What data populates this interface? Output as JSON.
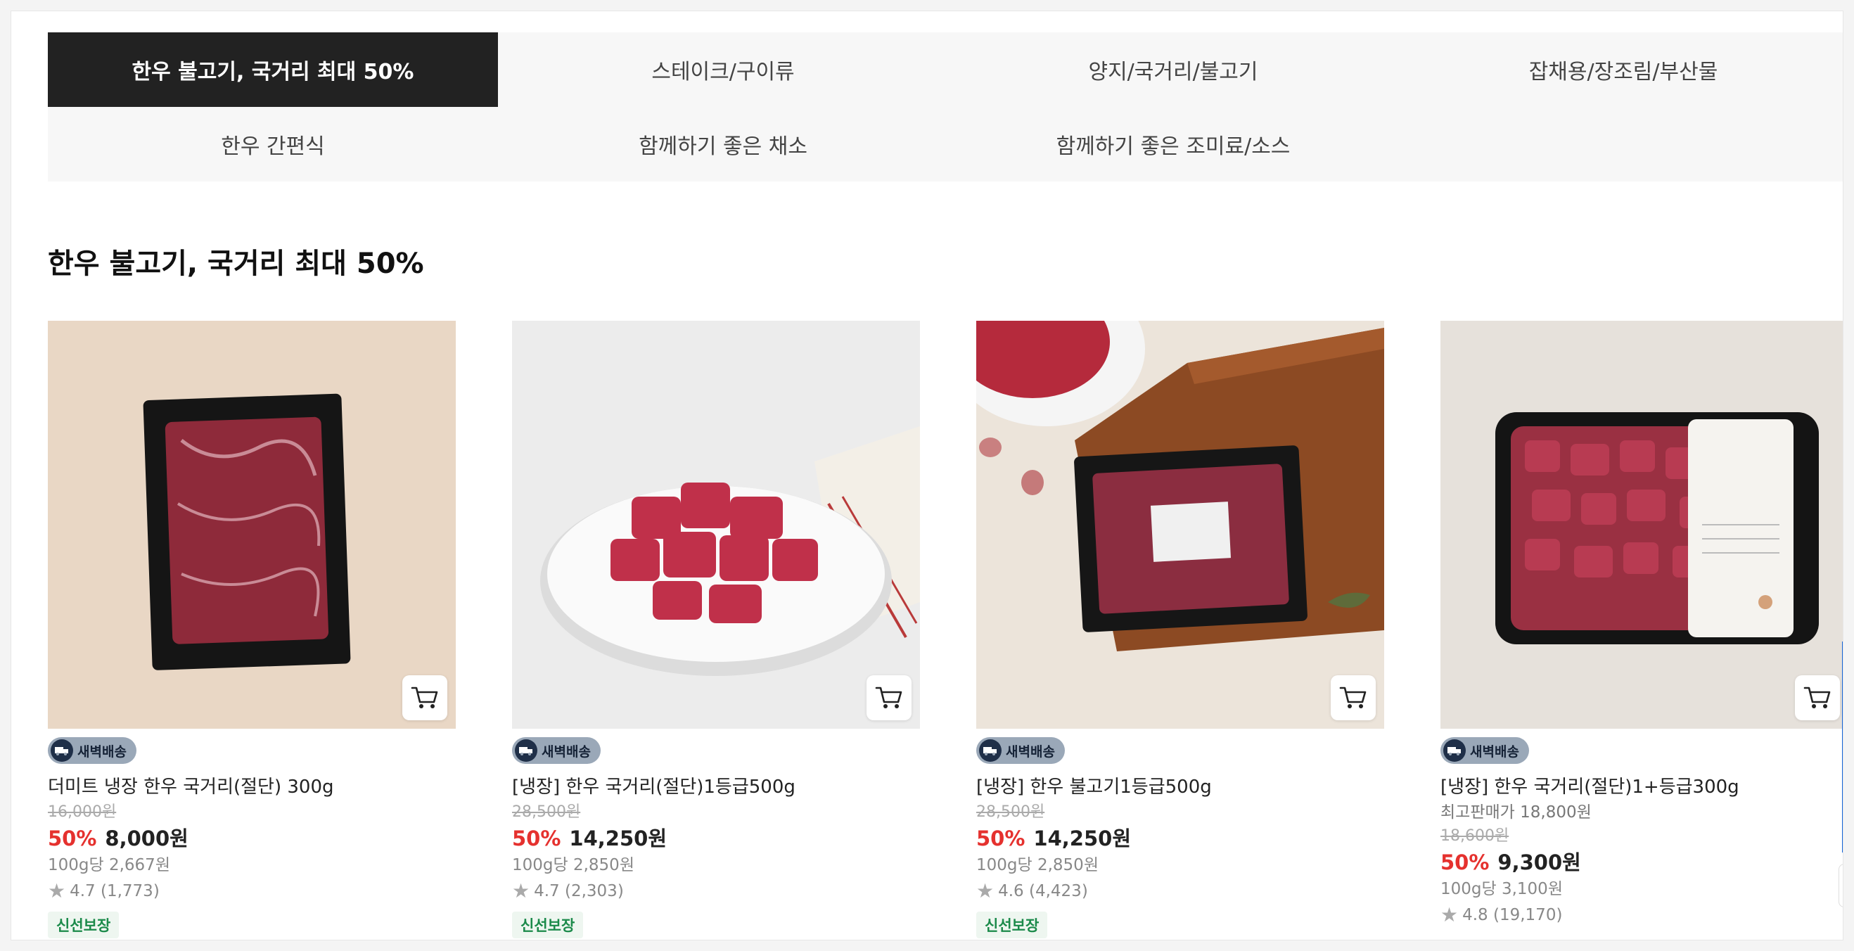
{
  "tabs_row1": [
    "한우 불고기, 국거리 최대 50%",
    "스테이크/구이류",
    "양지/국거리/불고기",
    "잡채용/장조림/부산물"
  ],
  "tabs_row2": [
    "한우 간편식",
    "함께하기 좋은 채소",
    "함께하기 좋은 조미료/소스",
    ""
  ],
  "active_tab": "한우 불고기, 국거리 최대 50%",
  "section_title": "한우 불고기, 국거리 최대 50%",
  "delivery_badge": "새벽배송",
  "fresh_badge": "신선보장",
  "products": [
    {
      "name": "더미트 냉장 한우 국거리(절단) 300g",
      "best_price": "",
      "original_price": "16,000원",
      "discount": "50%",
      "price": "8,000원",
      "unit_price": "100g당 2,667원",
      "rating": "4.7 (1,773)"
    },
    {
      "name": "[냉장] 한우 국거리(절단)1등급500g",
      "best_price": "",
      "original_price": "28,500원",
      "discount": "50%",
      "price": "14,250원",
      "unit_price": "100g당 2,850원",
      "rating": "4.7 (2,303)"
    },
    {
      "name": "[냉장] 한우 불고기1등급500g",
      "best_price": "",
      "original_price": "28,500원",
      "discount": "50%",
      "price": "14,250원",
      "unit_price": "100g당 2,850원",
      "rating": "4.6 (4,423)"
    },
    {
      "name": "[냉장] 한우 국거리(절단)1+등급300g",
      "best_price": "최고판매가 18,800원",
      "original_price": "18,600원",
      "discount": "50%",
      "price": "9,300원",
      "unit_price": "100g당 3,100원",
      "rating": "4.8 (19,170)"
    }
  ],
  "colors": {
    "accent_red": "#e5312e",
    "active_tab_bg": "#222222",
    "fresh_green": "#1b8a4a",
    "side_blue": "#1565d8"
  },
  "icons": [
    "cart-icon",
    "truck-icon",
    "star-icon"
  ]
}
